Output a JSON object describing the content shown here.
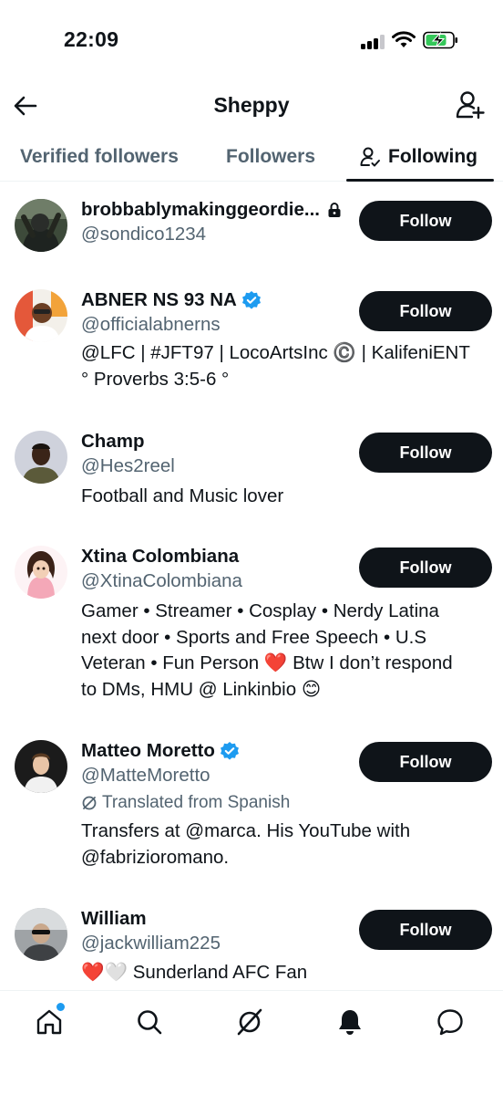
{
  "status_bar": {
    "time": "22:09"
  },
  "header": {
    "title": "Sheppy"
  },
  "tabs": [
    {
      "label": "Verified followers",
      "active": false
    },
    {
      "label": "Followers",
      "active": false
    },
    {
      "label": "Following",
      "active": true
    }
  ],
  "users": [
    {
      "name": "brobbablymakinggeordie...",
      "handle": "@sondico1234",
      "protected": true,
      "verified": false,
      "bio": [],
      "follow_label": "Follow"
    },
    {
      "name": "ABNER NS 93 NA",
      "handle": "@officialabnerns",
      "verified": true,
      "bio": [
        "@LFC | #JFT97 | LocoArtsInc ©️  | KalifeniENT",
        "° Proverbs 3:5-6 °"
      ],
      "follow_label": "Follow"
    },
    {
      "name": "Champ",
      "handle": "@Hes2reel",
      "verified": false,
      "bio": [
        "Football and Music lover"
      ],
      "follow_label": "Follow"
    },
    {
      "name": "Xtina Colombiana",
      "handle": "@XtinaColombiana",
      "verified": false,
      "bio": [
        "Gamer • Streamer • Cosplay • Nerdy Latina",
        "next door • Sports and Free Speech • U.S",
        "Veteran • Fun Person ❤️ Btw I don’t respond",
        "to DMs, HMU @ Linkinbio 😊"
      ],
      "follow_label": "Follow"
    },
    {
      "name": "Matteo Moretto",
      "handle": "@MatteMoretto",
      "verified": true,
      "translated_note": "Translated from Spanish",
      "bio": [
        "Transfers at @marca. His YouTube with",
        "@fabrizioromano."
      ],
      "follow_label": "Follow"
    },
    {
      "name": "William",
      "handle": "@jackwilliam225",
      "verified": false,
      "bio": [
        "❤️🤍 Sunderland AFC Fan"
      ],
      "follow_label": "Follow"
    }
  ],
  "bottom_nav": [
    "home-icon",
    "search-icon",
    "grok-icon",
    "notifications-icon",
    "messages-icon"
  ],
  "colors": {
    "verified": "#1d9bf0",
    "button": "#0f1419",
    "secondary_text": "#536471"
  }
}
